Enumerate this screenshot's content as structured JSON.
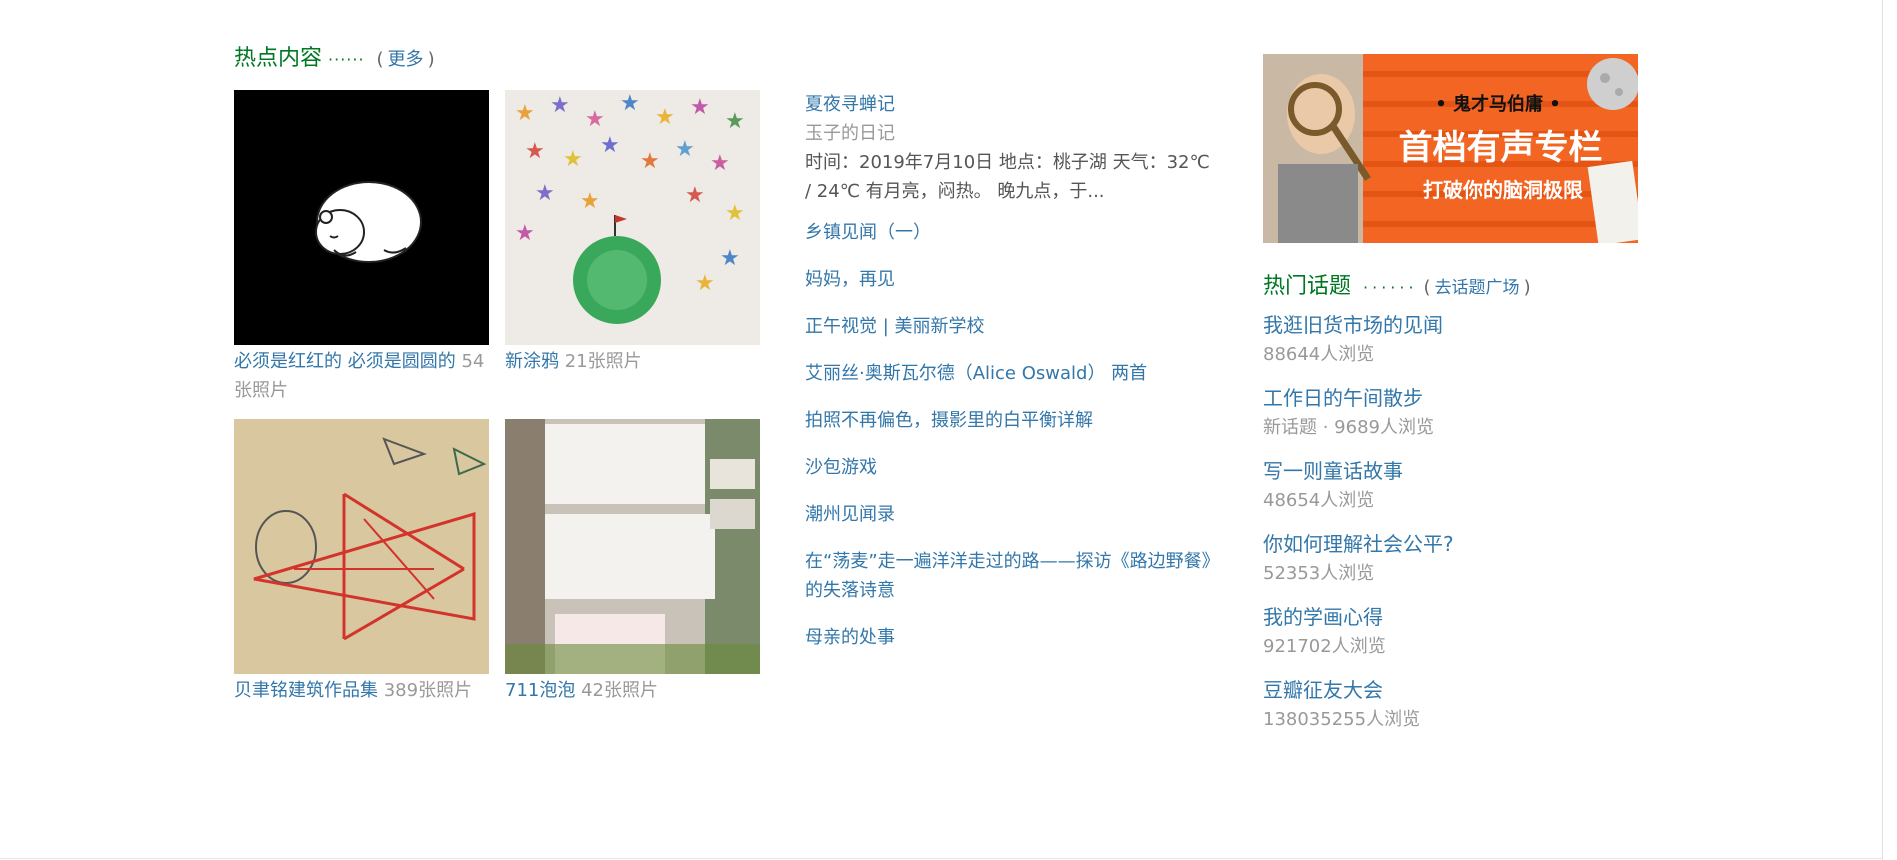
{
  "hot": {
    "title": "热点内容",
    "dots": "······",
    "paren_open": "(",
    "more": "更多",
    "paren_close": ")",
    "albums": [
      {
        "name": "必须是红红的 必须是圆圆的",
        "count": "54张照片"
      },
      {
        "name": "新涂鸦",
        "count": "21张照片"
      },
      {
        "name": "贝聿铭建筑作品集",
        "count": "389张照片"
      },
      {
        "name": "711泡泡",
        "count": "42张照片"
      }
    ]
  },
  "featured": {
    "title": "夏夜寻蝉记",
    "author": "玉子的日记",
    "desc": "时间：2019年7月10日 地点：桃子湖 天气：32℃ / 24℃ 有月亮，闷热。 晚九点，于..."
  },
  "articles": [
    "乡镇见闻（一）",
    "妈妈，再见",
    "正午视觉 | 美丽新学校",
    "艾丽丝·奥斯瓦尔德（Alice Oswald） 两首",
    "拍照不再偏色，摄影里的白平衡详解",
    "沙包游戏",
    "潮州见闻录",
    "在“荡麦”走一遍洋洋走过的路——探访《路边野餐》的失落诗意",
    "母亲的处事"
  ],
  "banner": {
    "top_line": "• 鬼才马伯庸 •",
    "main_line": "首档有声专栏",
    "sub_line": "打破你的脑洞极限"
  },
  "topics": {
    "title": "热门话题",
    "dots": "······",
    "paren_open": "(",
    "square_link": "去话题广场",
    "paren_close": ")",
    "items": [
      {
        "title": "我逛旧货市场的见闻",
        "meta": "88644人浏览"
      },
      {
        "title": "工作日的午间散步",
        "meta": "新话题 · 9689人浏览"
      },
      {
        "title": "写一则童话故事",
        "meta": "48654人浏览"
      },
      {
        "title": "你如何理解社会公平?",
        "meta": "52353人浏览"
      },
      {
        "title": "我的学画心得",
        "meta": "921702人浏览"
      },
      {
        "title": "豆瓣征友大会",
        "meta": "138035255人浏览"
      }
    ]
  },
  "colors": {
    "link": "#3377aa",
    "green": "#007722",
    "grey": "#999999",
    "banner_orange": "#f26522"
  }
}
